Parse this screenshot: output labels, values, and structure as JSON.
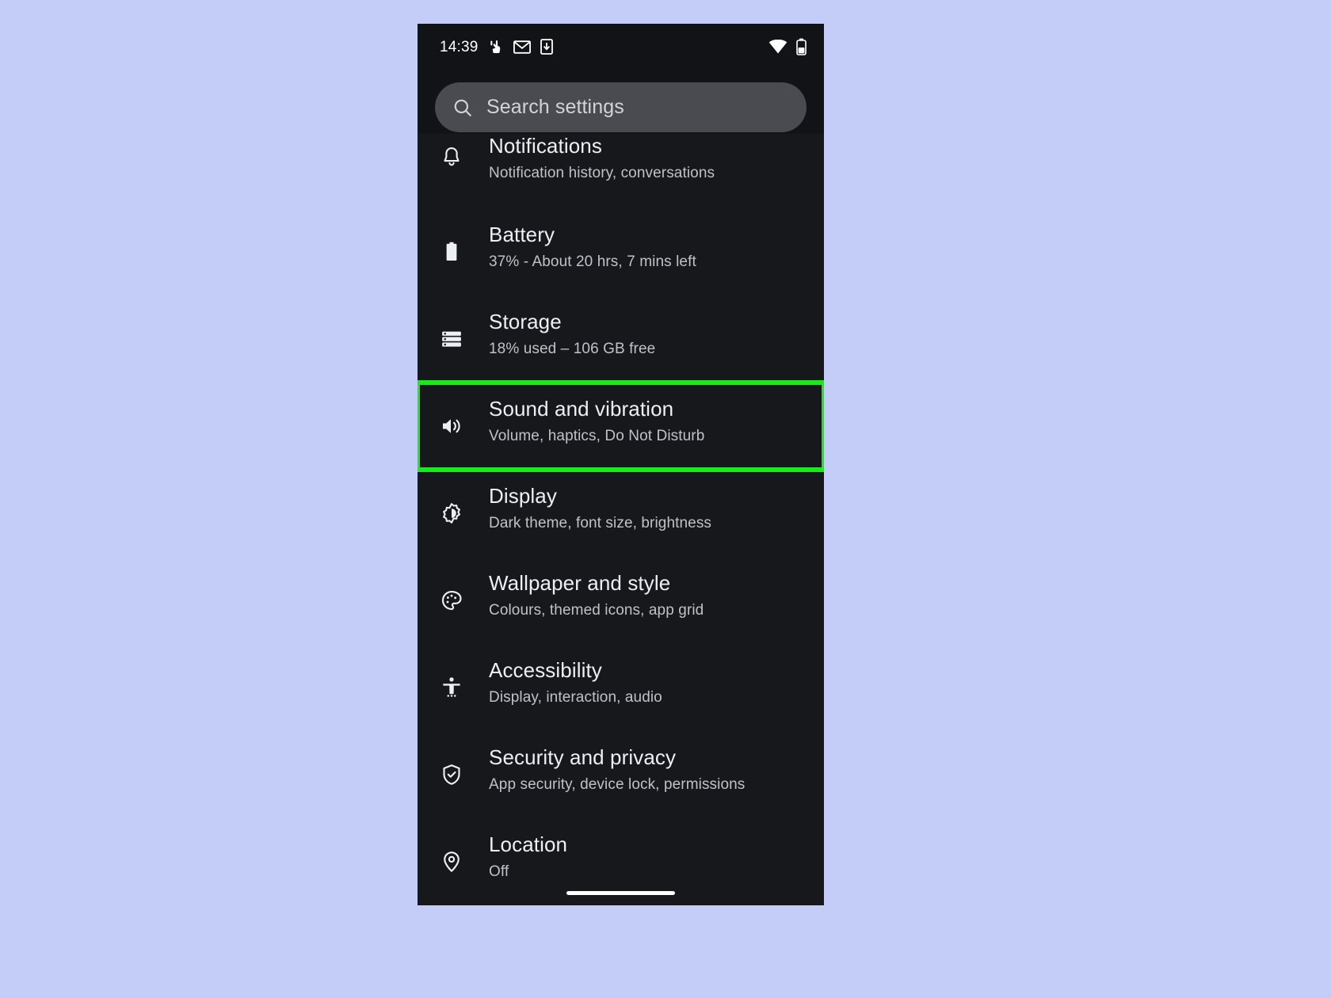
{
  "device": {
    "background_color": "#c3cdf7",
    "screen_background": "#17181c",
    "highlight_color": "#19ea19"
  },
  "status_bar": {
    "clock": "14:39",
    "left_icons": [
      "screen-record-icon",
      "gmail-icon",
      "download-icon"
    ],
    "right_icons": [
      "wifi-icon",
      "battery-icon"
    ]
  },
  "search": {
    "placeholder": "Search settings",
    "icon": "search-icon"
  },
  "settings_rows": [
    {
      "id": "notifications",
      "icon": "bell-icon",
      "title": "Notifications",
      "subtitle": "Notification history, conversations",
      "highlighted": false
    },
    {
      "id": "battery",
      "icon": "battery-icon",
      "title": "Battery",
      "subtitle": "37% - About 20 hrs, 7 mins left",
      "highlighted": false
    },
    {
      "id": "storage",
      "icon": "storage-icon",
      "title": "Storage",
      "subtitle": "18% used – 106 GB free",
      "highlighted": false
    },
    {
      "id": "sound",
      "icon": "volume-icon",
      "title": "Sound and vibration",
      "subtitle": "Volume, haptics, Do Not Disturb",
      "highlighted": true
    },
    {
      "id": "display",
      "icon": "brightness-icon",
      "title": "Display",
      "subtitle": "Dark theme, font size, brightness",
      "highlighted": false
    },
    {
      "id": "wallpaper",
      "icon": "palette-icon",
      "title": "Wallpaper and style",
      "subtitle": "Colours, themed icons, app grid",
      "highlighted": false
    },
    {
      "id": "accessibility",
      "icon": "accessibility-icon",
      "title": "Accessibility",
      "subtitle": "Display, interaction, audio",
      "highlighted": false
    },
    {
      "id": "security",
      "icon": "shield-check-icon",
      "title": "Security and privacy",
      "subtitle": "App security, device lock, permissions",
      "highlighted": false
    },
    {
      "id": "location",
      "icon": "location-pin-icon",
      "title": "Location",
      "subtitle": "Off",
      "highlighted": false
    }
  ],
  "navigation": {
    "gesture_pill": "home-gesture-pill"
  }
}
